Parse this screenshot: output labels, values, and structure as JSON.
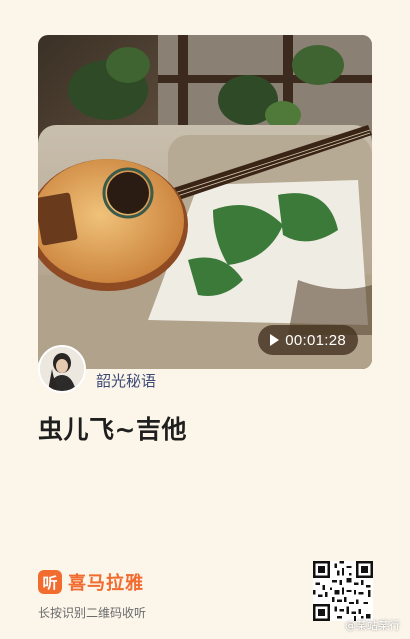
{
  "card": {
    "duration": "00:01:28",
    "author_name": "韶光秘语",
    "track_title": "虫儿飞~吉他"
  },
  "footer": {
    "brand_logo_text": "听",
    "brand_name": "喜马拉雅",
    "hint": "长按识别二维码收听",
    "watermark": "@某站某行"
  },
  "icons": {
    "play": "play-icon",
    "brand": "ximalaya-logo-icon",
    "qr": "qr-code"
  },
  "colors": {
    "background": "#fbf5ea",
    "brand": "#f26b2f",
    "author": "#3d4a78",
    "title": "#1f1f1f"
  }
}
